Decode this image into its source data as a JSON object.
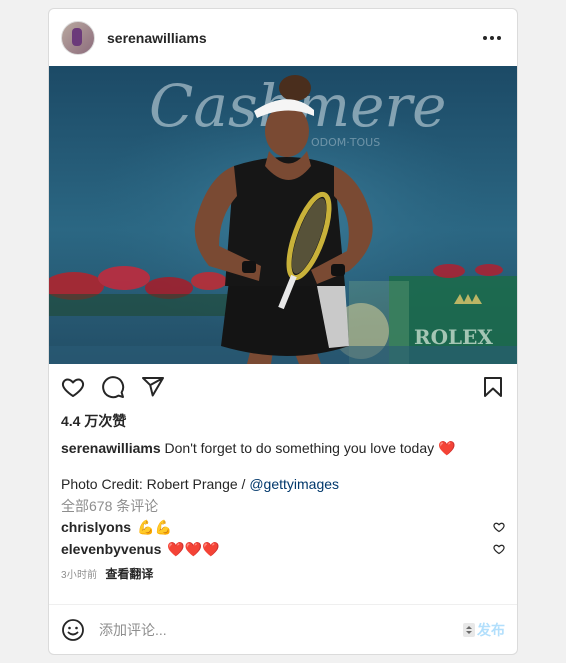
{
  "post": {
    "username": "serenawilliams",
    "likes": "4.4 万次赞",
    "caption": {
      "username": "serenawilliams",
      "text": "Don't forget to do something you love today",
      "emoji": "❤️"
    },
    "credit": {
      "text": "Photo Credit: Robert Prange / ",
      "mention": "@gettyimages"
    },
    "view_all_comments": "全部678 条评论",
    "comments": [
      {
        "username": "chrislyons",
        "text": "💪💪"
      },
      {
        "username": "elevenbyvenus",
        "text": "❤️❤️❤️"
      }
    ],
    "time": "3小时前",
    "translate": "查看翻译"
  },
  "photo": {
    "sign_text": "Cashmere",
    "sub_sign": "ODOM·TOUS",
    "board_text": "ROLEX"
  },
  "composer": {
    "placeholder": "添加评论...",
    "post_label": "发布"
  },
  "icons": {
    "more": "more-options-icon",
    "like": "heart-icon",
    "comment": "comment-icon",
    "share": "paper-plane-icon",
    "save": "bookmark-icon",
    "emoji": "smiley-icon"
  },
  "colors": {
    "link": "#00376b",
    "secondary": "#8e8e8e",
    "post_button_disabled": "#b2dffc",
    "heart_red": "#ed4956"
  }
}
